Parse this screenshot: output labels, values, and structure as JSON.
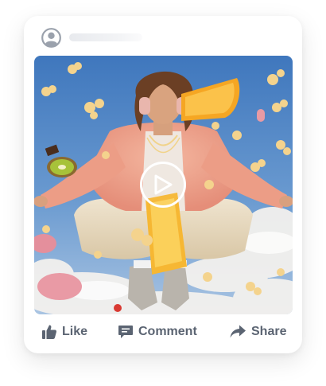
{
  "post": {
    "author_name_placeholder": "",
    "media": {
      "type": "video",
      "play_icon": "play-icon"
    },
    "actions": {
      "like_label": "Like",
      "comment_label": "Comment",
      "share_label": "Share"
    }
  },
  "icons": {
    "avatar": "user-circle-icon",
    "like": "thumbs-up-icon",
    "comment": "comment-icon",
    "share": "share-arrow-icon"
  },
  "colors": {
    "icon_gray": "#5b6472",
    "avatar_gray": "#9aa1ac",
    "sky": "#4f86c6",
    "card_bg": "#ffffff"
  }
}
